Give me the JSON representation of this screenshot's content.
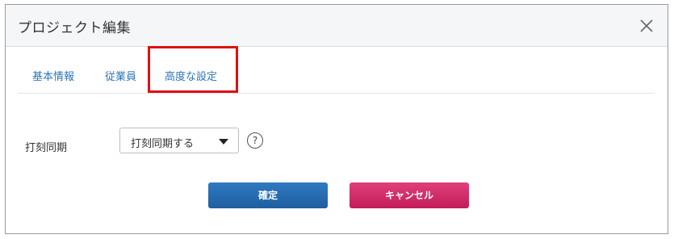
{
  "dialog": {
    "title": "プロジェクト編集",
    "close_icon": "close-icon"
  },
  "tabs": [
    {
      "label": "基本情報"
    },
    {
      "label": "従業員"
    },
    {
      "label": "高度な設定"
    }
  ],
  "form": {
    "punch_sync_label": "打刻同期",
    "punch_sync_value": "打刻同期する",
    "help_label": "?"
  },
  "buttons": {
    "ok_label": "確定",
    "cancel_label": "キャンセル"
  },
  "colors": {
    "tab_text": "#2e75b6",
    "ok_button": "#2a6fb5",
    "cancel_button": "#d02a68",
    "highlight": "#e01010"
  }
}
